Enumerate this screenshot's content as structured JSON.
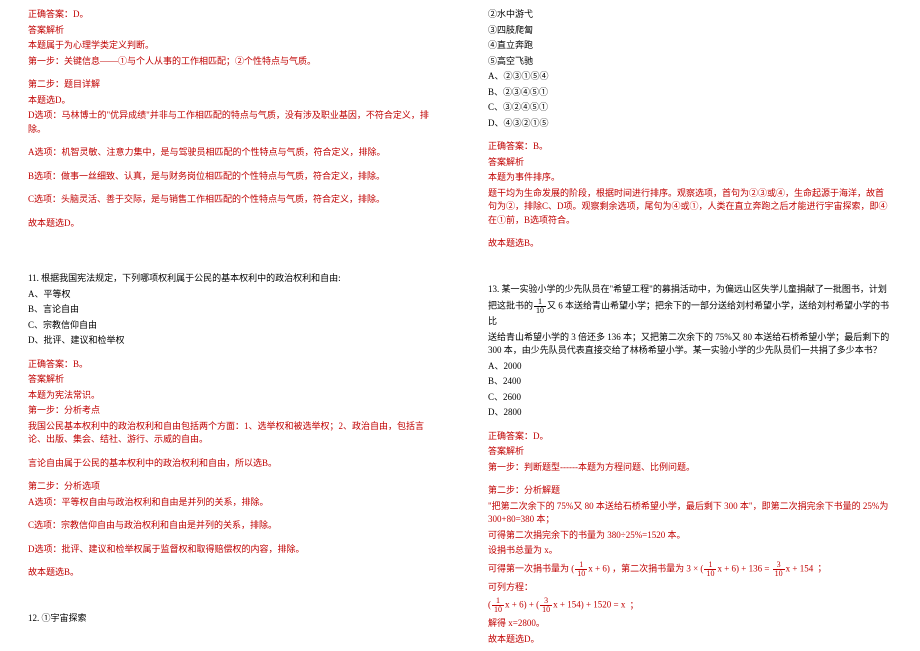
{
  "left": {
    "ans10_correct": "正确答案：D。",
    "ans10_header": "答案解析",
    "ans10_intro": "本题属于为心理学类定义判断。",
    "ans10_step1a": "第一步：关键信息——①与个人从事的工作相匹配；②个性特点与气质。",
    "ans10_step2": "第二步：题目详解",
    "ans10_pick": "本题选D。",
    "ans10_d": "D选项：马林博士的\"优异成绩\"并非与工作相匹配的特点与气质，没有涉及职业基因，不符合定义，排除。",
    "ans10_a": "A选项：机智灵敏、注意力集中，是与驾驶员相匹配的个性特点与气质，符合定义，排除。",
    "ans10_b": "B选项：做事一丝细致、认真，是与财务岗位相匹配的个性特点与气质，符合定义，排除。",
    "ans10_c": "C选项：头脑灵活、善于交际，是与销售工作相匹配的个性特点与气质，符合定义，排除。",
    "ans10_final": "故本题选D。",
    "q11_stem": "11. 根据我国宪法规定，下列哪项权利属于公民的基本权利中的政治权利和自由:",
    "q11_a": "A、平等权",
    "q11_b": "B、言论自由",
    "q11_c": "C、宗教信仰自由",
    "q11_d": "D、批评、建议和检举权",
    "ans11_correct": "正确答案：B。",
    "ans11_header": "答案解析",
    "ans11_intro": "本题为宪法常识。",
    "ans11_step1": "第一步：分析考点",
    "ans11_p1": "我国公民基本权利中的政治权利和自由包括两个方面：1、选举权和被选举权；2、政治自由，包括言论、出版、集会、结社、游行、示威的自由。",
    "ans11_p2": "言论自由属于公民的基本权利中的政治权利和自由，所以选B。",
    "ans11_step2": "第二步：分析选项",
    "ans11_a": "A选项：平等权自由与政治权利和自由是并列的关系，排除。",
    "ans11_c": "C选项：宗教信仰自由与政治权利和自由是并列的关系，排除。",
    "ans11_d": "D选项：批评、建议和检举权属于监督权和取得赔偿权的内容，排除。",
    "ans11_final": "故本题选B。",
    "q12_title": "12. ①宇宙探索"
  },
  "right": {
    "q12_2": "②水中游弋",
    "q12_3": "③四肢爬匐",
    "q12_4": "④直立奔跑",
    "q12_5": "⑤高空飞驰",
    "q12_a": "A、②③①⑤④",
    "q12_b": "B、②③④⑤①",
    "q12_c": "C、③②④⑤①",
    "q12_d": "D、④③②①⑤",
    "ans12_correct": "正确答案：B。",
    "ans12_header": "答案解析",
    "ans12_type": "本题为事件排序。",
    "ans12_p1": "题干均为生命发展的阶段，根据时间进行排序。观察选项，首句为②③或④，生命起源于海洋，故首句为②，排除C、D项。观察剩余选项，尾句为④或①，人类在直立奔跑之后才能进行宇宙探索，即④在①前，B选项符合。",
    "ans12_final": "故本题选B。",
    "q13_stem1": "13. 某一实验小学的少先队员在\"希望工程\"的募捐活动中，为偏远山区失学儿童捐献了一批图书，计划",
    "q13_stem2a": "把这批书的",
    "q13_stem2b": "又 6 本送给青山希望小学；把余下的一部分送给刘村希望小学，送给刘村希望小学的书比",
    "q13_stem3": "送给青山希望小学的 3 倍还多 136 本；又把第二次余下的 75%又 80 本送给石桥希望小学；最后剩下的 300 本，由少先队员代表直接交给了林杨希望小学。某一实验小学的少先队员们一共捐了多少本书？",
    "q13_a": "A、2000",
    "q13_b": "B、2400",
    "q13_c": "C、2600",
    "q13_d": "D、2800",
    "ans13_correct": "正确答案：D。",
    "ans13_header": "答案解析",
    "ans13_step1": "第一步：判断题型------本题为方程问题、比例问题。",
    "ans13_step2": "第二步：分析解题",
    "ans13_p1": "\"把第二次余下的 75%又 80 本送给石桥希望小学，最后剩下 300 本\"，即第二次捐完余下书量的 25%为 300+80=380 本；",
    "ans13_p2": "可得第二次捐完余下的书量为 380÷25%=1520 本。",
    "ans13_p3": "设捐书总量为 x。",
    "ans13_m1a": "可得第一次捐书量为",
    "ans13_m1b": "，第二次捐书量为",
    "ans13_m1c": "；",
    "ans13_p4": "可列方程：",
    "ans13_m2_tail": "；",
    "ans13_p5": "解得 x=2800。",
    "ans13_final": "故本题选D。"
  }
}
